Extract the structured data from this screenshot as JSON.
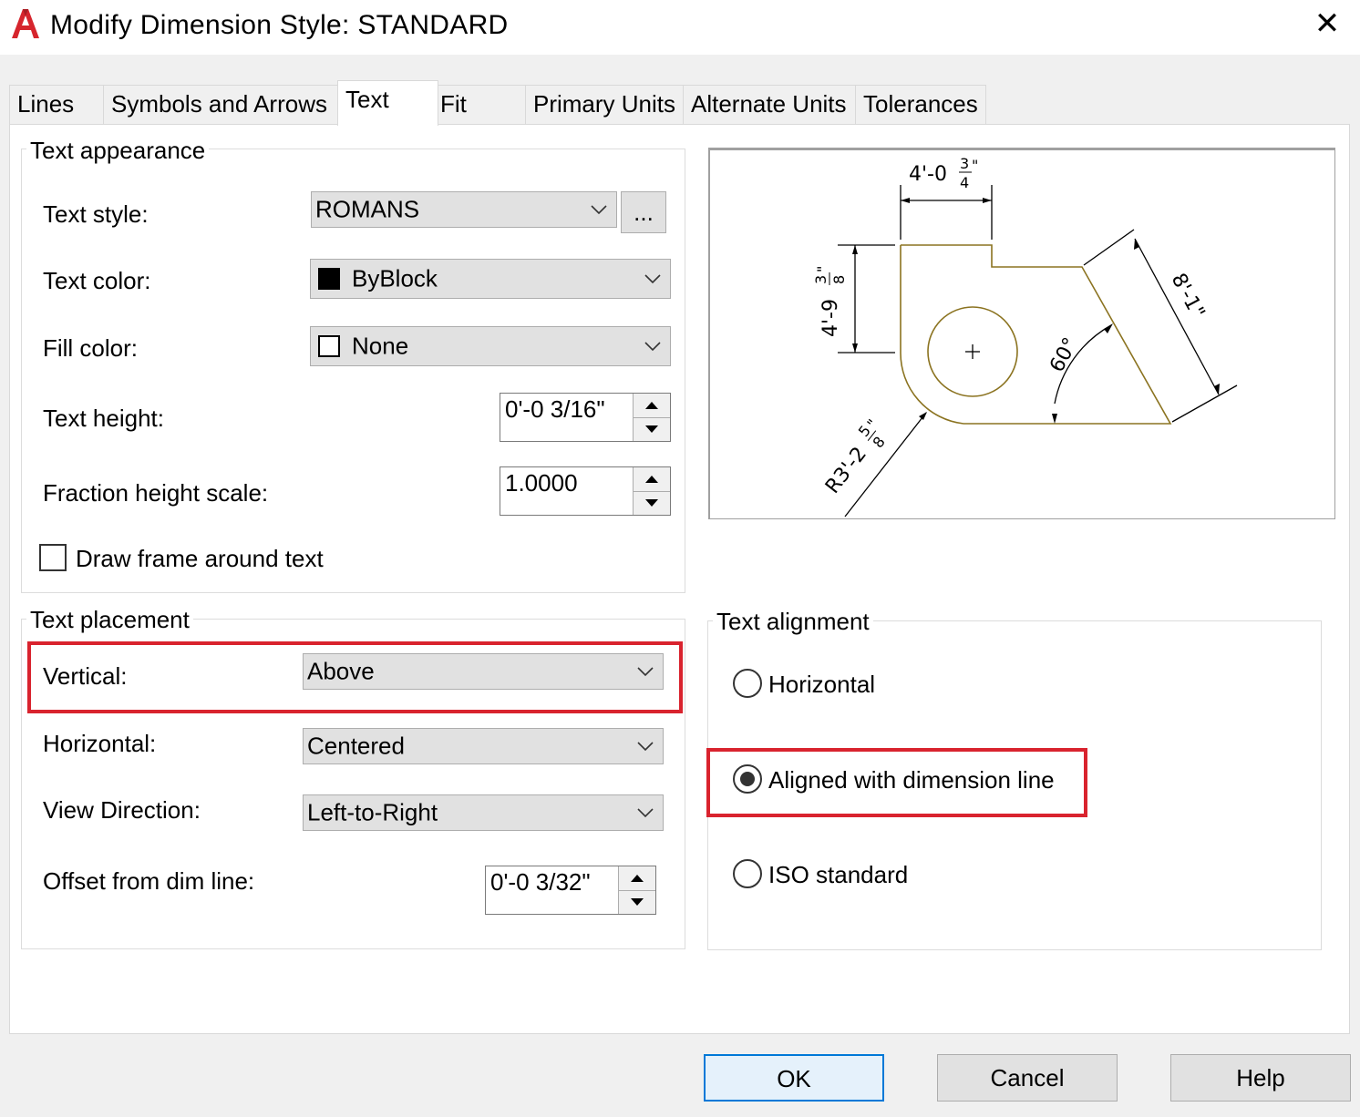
{
  "window": {
    "title": "Modify Dimension Style: STANDARD",
    "close_glyph": "✕",
    "accent_color": "#0078d7",
    "highlight_color": "#d9232e"
  },
  "tabs": [
    {
      "label": "Lines",
      "active": false
    },
    {
      "label": "Symbols and Arrows",
      "active": false
    },
    {
      "label": "Text",
      "active": true
    },
    {
      "label": "Fit",
      "active": false
    },
    {
      "label": "Primary Units",
      "active": false
    },
    {
      "label": "Alternate Units",
      "active": false
    },
    {
      "label": "Tolerances",
      "active": false
    }
  ],
  "text_appearance": {
    "legend": "Text appearance",
    "text_style": {
      "label": "Text style:",
      "value": "ROMANS",
      "browse_label": "..."
    },
    "text_color": {
      "label": "Text color:",
      "value": "ByBlock",
      "swatch": "#000000"
    },
    "fill_color": {
      "label": "Fill color:",
      "value": "None",
      "swatch": "#ffffff"
    },
    "text_height": {
      "label": "Text height:",
      "value": "0'-0 3/16\""
    },
    "fraction_height_scale": {
      "label": "Fraction height scale:",
      "value": "1.0000"
    },
    "draw_frame": {
      "label": "Draw frame around text",
      "checked": false
    }
  },
  "preview": {
    "top_dim": {
      "whole": "4'-0",
      "num": "3",
      "den": "4",
      "inch": "\""
    },
    "left_dim": {
      "whole": "4'-9",
      "num": "3",
      "den": "8",
      "inch": "\""
    },
    "right_dim": "8'-1\"",
    "angle_dim": "60°",
    "radius_dim": {
      "whole": "R3'-2",
      "num": "5",
      "den": "8",
      "inch": "\""
    },
    "geometry_color": "#8b7320"
  },
  "text_placement": {
    "legend": "Text placement",
    "vertical": {
      "label": "Vertical:",
      "value": "Above"
    },
    "horizontal": {
      "label": "Horizontal:",
      "value": "Centered"
    },
    "view_direction": {
      "label": "View Direction:",
      "value": "Left-to-Right"
    },
    "offset": {
      "label": "Offset from dim line:",
      "value": "0'-0 3/32\""
    }
  },
  "text_alignment": {
    "legend": "Text alignment",
    "options": [
      {
        "label": "Horizontal",
        "selected": false
      },
      {
        "label": "Aligned with dimension line",
        "selected": true
      },
      {
        "label": "ISO standard",
        "selected": false
      }
    ]
  },
  "footer": {
    "ok_label": "OK",
    "cancel_label": "Cancel",
    "help_label": "Help"
  }
}
